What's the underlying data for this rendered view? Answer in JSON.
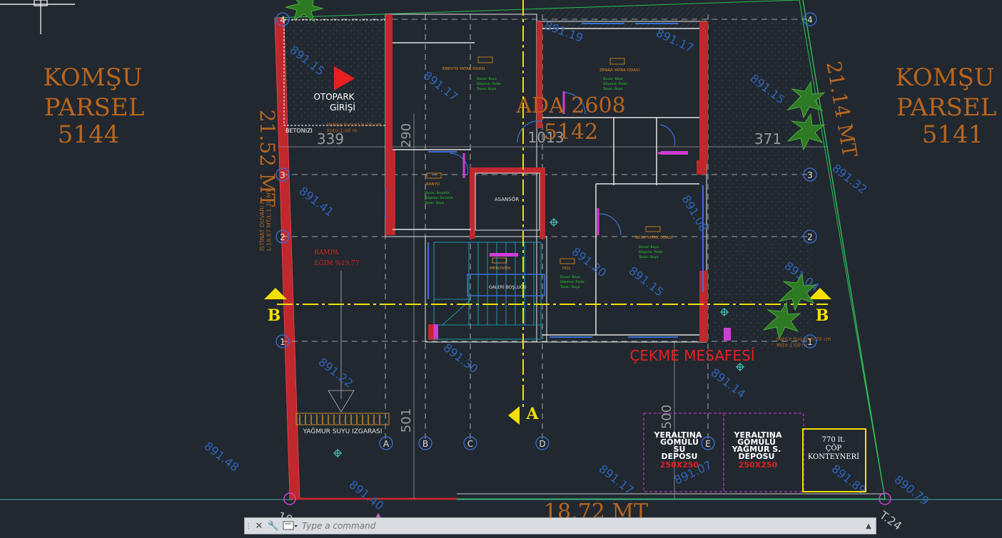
{
  "labels": {
    "left_parcel_line1": "KOMŞU",
    "left_parcel_line2": "PARSEL",
    "left_parcel_num": "5144",
    "right_parcel_line1": "KOMŞU",
    "right_parcel_line2": "PARSEL",
    "right_parcel_num": "5141",
    "parking_line1": "OTOPARK",
    "parking_line2": "GİRİŞİ",
    "betonizi": "BETONIZI",
    "ramp_line1": "RAMPA",
    "ramp_line2": "EĞİM %19,77",
    "setback": "ÇEKME MESAFESİ",
    "rain_grate": "YAĞMUR SUYU IZGARASI",
    "dim_left": "21.52 MT",
    "dim_right": "21.14 MT",
    "dim_bottom": "18.72 MT",
    "ada": "ADA 2608",
    "parsel": "5142",
    "elevator": "ASANSÖR",
    "section_a": "A",
    "section_b_left": "B",
    "section_b_right": "B",
    "room_master": "EBEVYN YATAK ODASI",
    "room_child": "ZENRA YATAK ODASI",
    "room_bath": "BANYO",
    "room_hol": "HOL",
    "room_sleep": "NEVA YATAK ODASI",
    "room_stairs": "MERDİVEN",
    "gallery": "GALERİ BOŞLUĞU",
    "wall_note_left": "bahçe duvarı h:20 cm\nKotu:1.00 m",
    "wall_note_right": "bahçe duvarı h:20 cm\nKotu:1.00 m",
    "retaining_wall": "İSTİNAT DUVARI I\nL:18.87 MT/L:1.20 MT"
  },
  "tanks": {
    "water_line1": "YERALTINA",
    "water_line2": "GÖMÜLÜ",
    "water_line3": "SU",
    "water_line4": "DEPOSU",
    "water_size": "250X250",
    "rain_line1": "YERALTINA",
    "rain_line2": "GÖMÜLÜ",
    "rain_line3": "YAĞMUR S.",
    "rain_line4": "DEPOSU",
    "rain_size": "250X250",
    "bin_line1": "770 lt.",
    "bin_line2": "ÇÖP",
    "bin_line3": "KONTEYNERİ"
  },
  "grid": {
    "rows": [
      "4",
      "3",
      "2",
      "1"
    ],
    "cols": [
      "A",
      "B",
      "C",
      "D",
      "E"
    ]
  },
  "elevations": [
    "891.15",
    "891.17",
    "891.19",
    "891.17",
    "891.15",
    "891.32",
    "891.41",
    "891.22",
    "891.48",
    "891.40",
    "891.30",
    "891.17",
    "891.07",
    "891.89",
    "890.79",
    "891.14",
    "891.04",
    "891.08",
    "891.15",
    "891.20"
  ],
  "dims": [
    "339",
    "290",
    "1013",
    "371",
    "501",
    "500",
    "10",
    "T.24"
  ],
  "command": {
    "placeholder": "Type a command"
  },
  "colors": {
    "background": "#212830",
    "wall": "#c0282d",
    "grid_bubble": "#3c6fd8",
    "parcel_text": "#b8651e",
    "section_line": "#f3e000",
    "elevation": "#2f64b8",
    "magenta": "#d23cd6",
    "green": "#2dbf55"
  }
}
